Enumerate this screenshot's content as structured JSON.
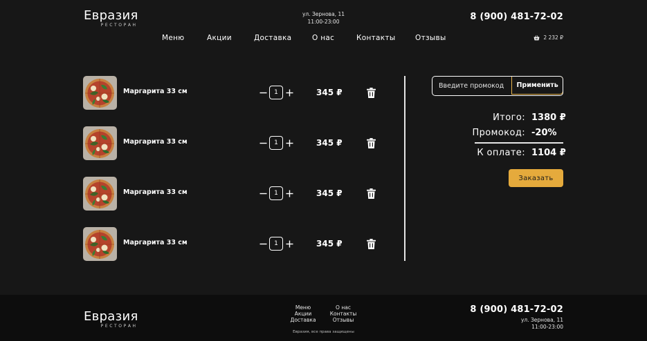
{
  "header": {
    "logo_main": "Евразия",
    "logo_sub": "РЕСТОРАН",
    "address_line1": "ул. Зернова, 11",
    "address_line2": "11:00-23:00",
    "phone": "8 (900) 481-72-02",
    "nav": [
      {
        "label": "Меню"
      },
      {
        "label": "Акции"
      },
      {
        "label": "Доставка"
      },
      {
        "label": "О нас"
      },
      {
        "label": "Контакты"
      },
      {
        "label": "Отзывы"
      }
    ],
    "cart_total": "2 232 ₽",
    "cart_icon": "basket-icon"
  },
  "cart": {
    "items": [
      {
        "name": "Маргарита 33 см",
        "qty": "1",
        "price": "345 ₽"
      },
      {
        "name": "Маргарита 33 см",
        "qty": "1",
        "price": "345 ₽"
      },
      {
        "name": "Маргарита 33 см",
        "qty": "1",
        "price": "345 ₽"
      },
      {
        "name": "Маргарита 33 см",
        "qty": "1",
        "price": "345 ₽"
      }
    ]
  },
  "summary": {
    "promo_placeholder": "Введите промокод",
    "apply_label": "Применить",
    "total_label": "Итого:",
    "total_value": "1380 ₽",
    "promo_label": "Промокод:",
    "promo_value": "-20%",
    "pay_label": "К оплате:",
    "pay_value": "1104 ₽",
    "order_label": "Заказать"
  },
  "footer": {
    "logo_main": "Евразия",
    "logo_sub": "РЕСТОРАН",
    "nav_col1": [
      "Меню",
      "Акции",
      "Доставка"
    ],
    "nav_col2": [
      "О нас",
      "Контакты",
      "Отзывы"
    ],
    "phone": "8 (900) 481-72-02",
    "address_line1": "ул. Зернова, 11",
    "address_line2": "11:00-23:00",
    "copyright": "Евразия, все права защищены"
  },
  "colors": {
    "background": "#171717",
    "footer_bg": "#0d0d0d",
    "accent": "#e5aa3c",
    "text": "#ffffff"
  }
}
